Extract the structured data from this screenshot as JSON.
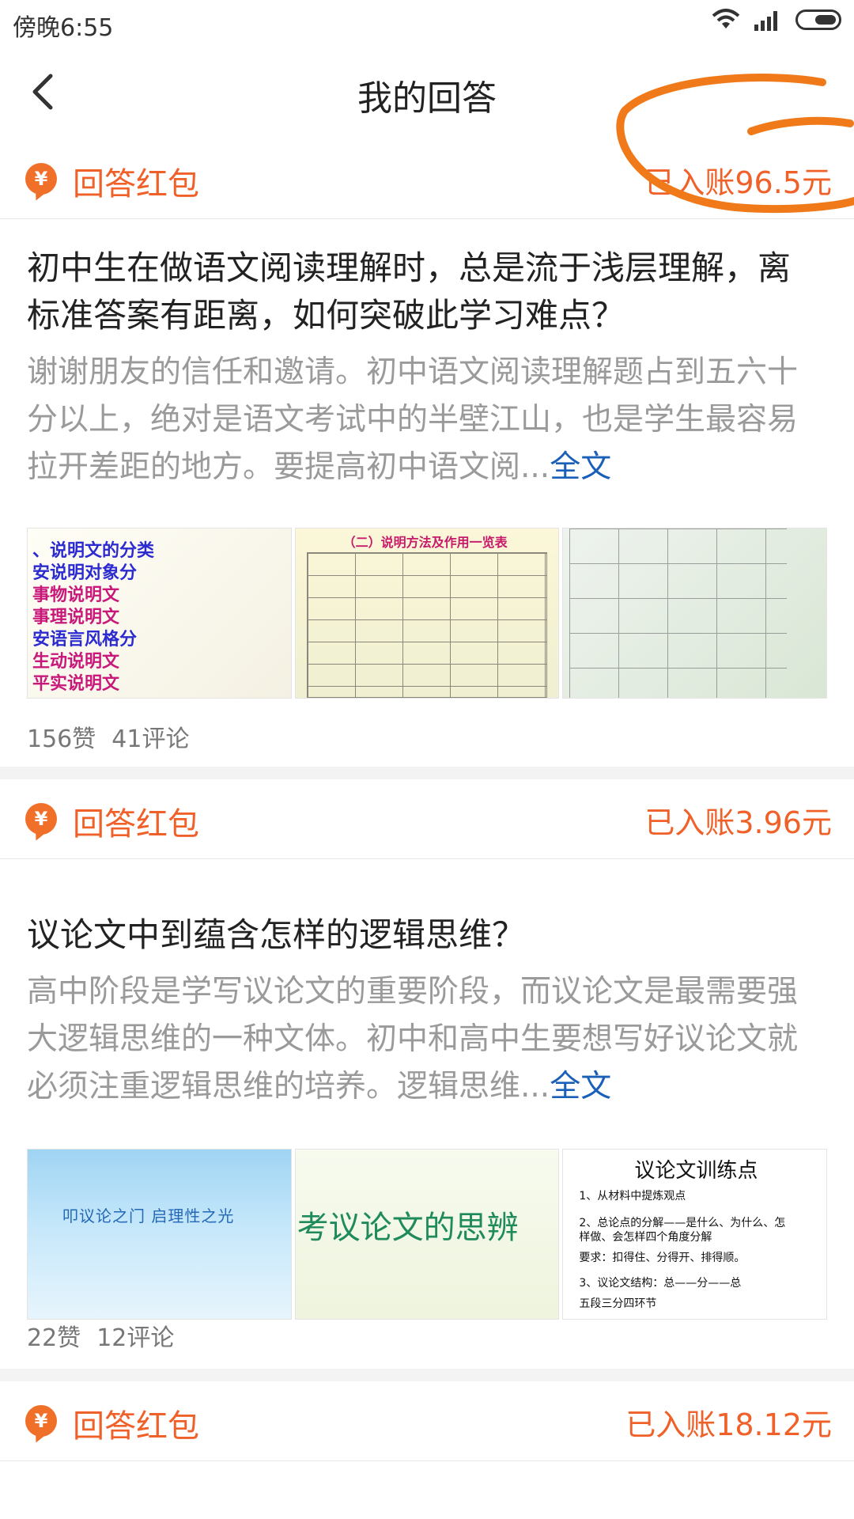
{
  "status_bar": {
    "time": "傍晚6:55"
  },
  "header": {
    "title": "我的回答"
  },
  "items": [
    {
      "packet_label": "回答红包",
      "packet_amount": "已入账96.5元",
      "question": "初中生在做语文阅读理解时，总是流于浅层理解，离标准答案有距离，如何突破此学习难点？",
      "excerpt": "谢谢朋友的信任和邀请。初中语文阅读理解题占到五六十分以上，绝对是语文考试中的半壁江山，也是学生最容易拉开差距的地方。要提高初中语文阅...",
      "more_label": "全文",
      "likes": "156赞",
      "comments": "41评论",
      "thumb1_lines": [
        "、说明文的分类",
        "安说明对象分",
        "  事物说明文",
        "  事理说明文",
        "安语言风格分",
        "生动说明文",
        "平实说明文"
      ],
      "thumb2_caption": "（二）说明方法及作用一览表"
    },
    {
      "packet_label": "回答红包",
      "packet_amount": "已入账3.96元",
      "question": "议论文中到蕴含怎样的逻辑思维？",
      "excerpt": "高中阶段是学写议论文的重要阶段，而议论文是最需要强大逻辑思维的一种文体。初中和高中生要想写好议论文就必须注重逻辑思维的培养。逻辑思维...",
      "more_label": "全文",
      "likes": "22赞",
      "comments": "12评论",
      "thumb1_text": "叩议论之门  启理性之光",
      "thumb2_text": "考议论文的思辨",
      "thumb3_title": "议论文训练点",
      "thumb3_lines": [
        "1、从材料中提炼观点",
        "2、总论点的分解——是什么、为什么、怎",
        "样做、会怎样四个角度分解",
        "要求：扣得住、分得开、排得顺。",
        "3、议论文结构：总——分——总",
        "   五段三分四环节"
      ]
    },
    {
      "packet_label": "回答红包",
      "packet_amount": "已入账18.12元"
    }
  ],
  "colors": {
    "accent": "#f0612a",
    "link": "#1a5fb8",
    "annotation": "#f07a1a"
  },
  "icons": {
    "back": "chevron-left-icon",
    "coin": "yuan-coin-icon",
    "wifi": "wifi-icon",
    "signal": "signal-icon",
    "battery": "battery-icon"
  }
}
